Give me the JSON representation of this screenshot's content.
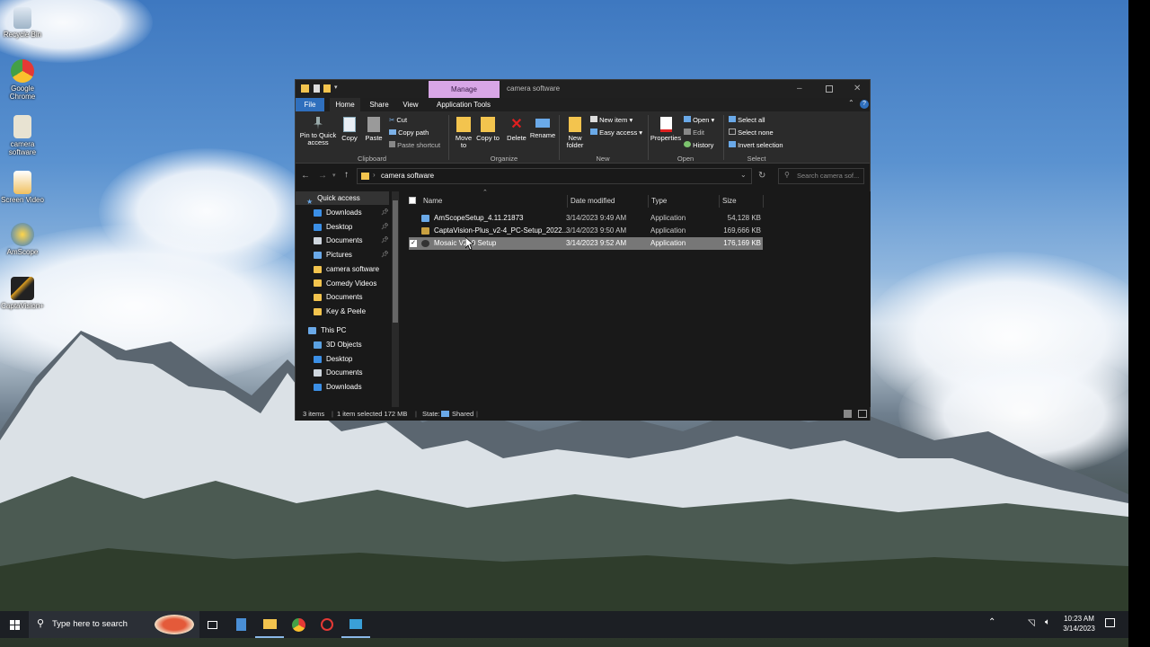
{
  "desktop": {
    "icons": [
      {
        "label": "Recycle Bin"
      },
      {
        "label": "Google Chrome"
      },
      {
        "label": "camera software"
      },
      {
        "label": "Screen Video"
      },
      {
        "label": "AmScope"
      },
      {
        "label": "CaptaVision+"
      }
    ]
  },
  "window": {
    "context_tab": "Manage",
    "title": "camera software",
    "tabs": [
      "File",
      "Home",
      "Share",
      "View",
      "Application Tools"
    ],
    "ribbon": {
      "clipboard": {
        "pin": "Pin to Quick access",
        "copy": "Copy",
        "paste": "Paste",
        "cut": "Cut",
        "copy_path": "Copy path",
        "paste_shortcut": "Paste shortcut",
        "label": "Clipboard"
      },
      "organize": {
        "move_to": "Move to",
        "copy_to": "Copy to",
        "delete": "Delete",
        "rename": "Rename",
        "label": "Organize"
      },
      "new": {
        "new_folder": "New folder",
        "new_item": "New item",
        "easy_access": "Easy access",
        "label": "New"
      },
      "open": {
        "properties": "Properties",
        "open": "Open",
        "edit": "Edit",
        "history": "History",
        "label": "Open"
      },
      "select": {
        "select_all": "Select all",
        "select_none": "Select none",
        "invert": "Invert selection",
        "label": "Select"
      }
    },
    "address": {
      "path": "camera software",
      "search_placeholder": "Search camera sof..."
    },
    "nav": {
      "quick_access": "Quick access",
      "quick_items": [
        {
          "label": "Downloads",
          "color": "#3b8fe6",
          "pinned": true
        },
        {
          "label": "Desktop",
          "color": "#3b8fe6",
          "pinned": true
        },
        {
          "label": "Documents",
          "color": "#cfd6de",
          "pinned": true
        },
        {
          "label": "Pictures",
          "color": "#6aa9e8",
          "pinned": true
        },
        {
          "label": "camera software",
          "color": "#f3c44e",
          "pinned": false
        },
        {
          "label": "Comedy Videos",
          "color": "#f3c44e",
          "pinned": false
        },
        {
          "label": "Documents",
          "color": "#f3c44e",
          "pinned": false
        },
        {
          "label": "Key & Peele",
          "color": "#f3c44e",
          "pinned": false
        }
      ],
      "this_pc": "This PC",
      "pc_items": [
        {
          "label": "3D Objects",
          "color": "#5aa0e0"
        },
        {
          "label": "Desktop",
          "color": "#3b8fe6"
        },
        {
          "label": "Documents",
          "color": "#cfd6de"
        },
        {
          "label": "Downloads",
          "color": "#3b8fe6"
        }
      ]
    },
    "columns": [
      "Name",
      "Date modified",
      "Type",
      "Size"
    ],
    "files": [
      {
        "name": "AmScopeSetup_4.11.21873",
        "date": "3/14/2023 9:49 AM",
        "type": "Application",
        "size": "54,128 KB",
        "selected": false
      },
      {
        "name": "CaptaVision-Plus_v2-4_PC-Setup_2022...",
        "date": "3/14/2023 9:50 AM",
        "type": "Application",
        "size": "169,666 KB",
        "selected": false
      },
      {
        "name": "Mosaic V2 .0 Setup",
        "date": "3/14/2023 9:52 AM",
        "type": "Application",
        "size": "176,169 KB",
        "selected": true
      }
    ],
    "status": {
      "items": "3 items",
      "selected": "1 item selected  172 MB",
      "state": "State:",
      "shared": "Shared"
    }
  },
  "taskbar": {
    "search_placeholder": "Type here to search",
    "time": "10:23 AM",
    "date": "3/14/2023"
  }
}
